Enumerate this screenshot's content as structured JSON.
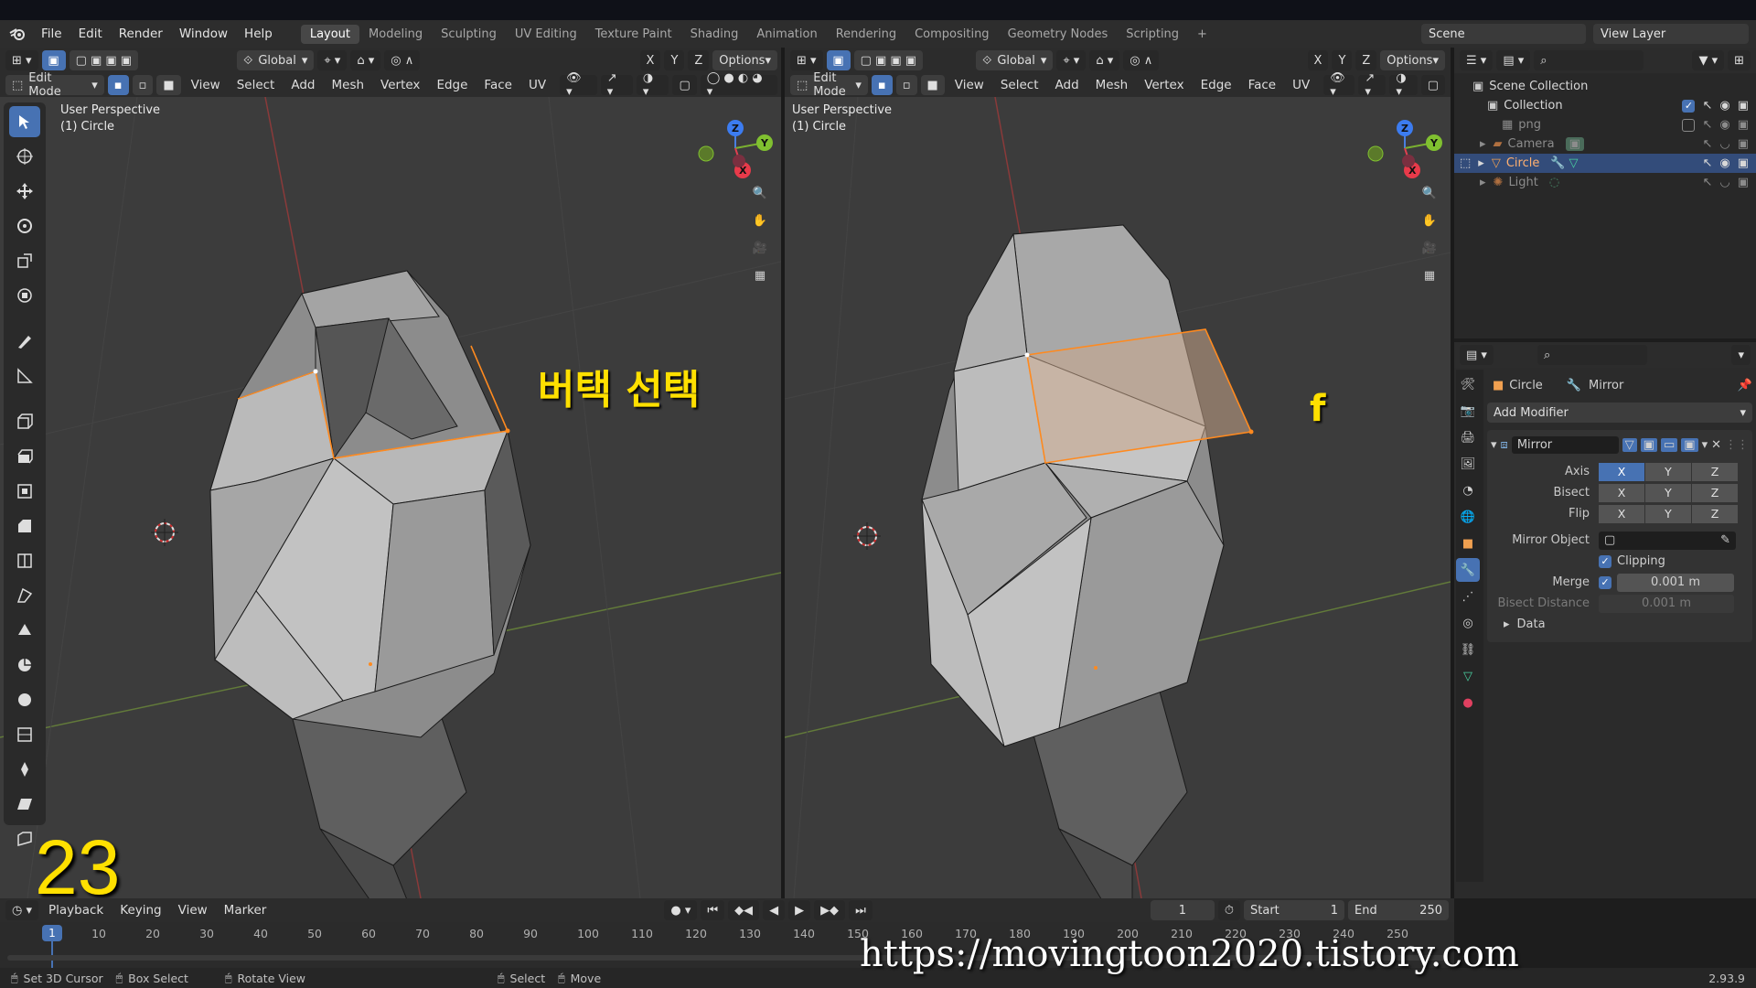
{
  "app": {
    "name": "Blender",
    "version": "2.93.9"
  },
  "menubar": {
    "items": [
      "File",
      "Edit",
      "Render",
      "Window",
      "Help"
    ],
    "workspaces": [
      "Layout",
      "Modeling",
      "Sculpting",
      "UV Editing",
      "Texture Paint",
      "Shading",
      "Animation",
      "Rendering",
      "Compositing",
      "Geometry Nodes",
      "Scripting"
    ],
    "active_workspace": "Layout",
    "scene": "Scene",
    "view_layer": "View Layer"
  },
  "viewport_header": {
    "orientation": "Global",
    "options": "Options",
    "mode": "Edit Mode",
    "menus": [
      "View",
      "Select",
      "Add",
      "Mesh",
      "Vertex",
      "Edge",
      "Face",
      "UV"
    ],
    "axes": [
      "X",
      "Y",
      "Z"
    ]
  },
  "viewport_left": {
    "perspective": "User Perspective",
    "object": "(1) Circle",
    "overlay_text": "버택 선택"
  },
  "viewport_right": {
    "perspective": "User Perspective",
    "object": "(1) Circle",
    "overlay_text": "f"
  },
  "outliner": {
    "root": "Scene Collection",
    "items": [
      {
        "name": "Collection",
        "indent": 1
      },
      {
        "name": "png",
        "indent": 2
      },
      {
        "name": "Camera",
        "indent": 2
      },
      {
        "name": "Circle",
        "indent": 2,
        "selected": true
      },
      {
        "name": "Light",
        "indent": 2
      }
    ]
  },
  "properties": {
    "object_name": "Circle",
    "modifier_tab": "Mirror",
    "add_modifier": "Add Modifier",
    "modifier_name": "Mirror",
    "axis_label": "Axis",
    "bisect_label": "Bisect",
    "flip_label": "Flip",
    "axes": [
      "X",
      "Y",
      "Z"
    ],
    "mirror_object_label": "Mirror Object",
    "clipping_label": "Clipping",
    "merge_label": "Merge",
    "merge_value": "0.001 m",
    "bisect_distance_label": "Bisect Distance",
    "bisect_distance_value": "0.001 m",
    "data_label": "Data"
  },
  "timeline": {
    "menus": [
      "Playback",
      "Keying",
      "View",
      "Marker"
    ],
    "current_frame": "1",
    "start_label": "Start",
    "start": "1",
    "end_label": "End",
    "end": "250",
    "ticks": [
      "1",
      "10",
      "20",
      "30",
      "40",
      "50",
      "60",
      "70",
      "80",
      "90",
      "100",
      "110",
      "120",
      "130",
      "140",
      "150",
      "160",
      "170",
      "180",
      "190",
      "200",
      "210",
      "220",
      "230",
      "240",
      "250"
    ]
  },
  "statusbar": {
    "items": [
      "Set 3D Cursor",
      "Box Select",
      "Rotate View",
      "Select",
      "Move"
    ],
    "version": "2.93.9"
  },
  "overlay": {
    "step_number": "23",
    "url": "https://movingtoon2020.tistory.com"
  },
  "colors": {
    "accent": "#4772b3",
    "selection_orange": "#ff8a1f",
    "overlay_yellow": "#ffe000"
  }
}
